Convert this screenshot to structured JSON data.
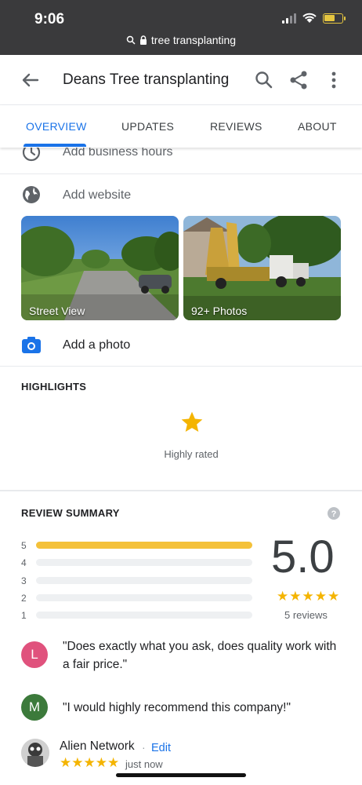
{
  "status_bar": {
    "time": "9:06"
  },
  "browser": {
    "url_text": "tree transplanting"
  },
  "header": {
    "title": "Deans Tree transplanting"
  },
  "tabs": [
    {
      "label": "OVERVIEW"
    },
    {
      "label": "UPDATES"
    },
    {
      "label": "REVIEWS"
    },
    {
      "label": "ABOUT"
    }
  ],
  "rows": {
    "hours_label": "Add business hours",
    "website_label": "Add website",
    "photo_label": "Add a photo"
  },
  "photos": [
    {
      "caption": "Street View"
    },
    {
      "caption": "92+ Photos"
    }
  ],
  "highlights": {
    "title": "HIGHLIGHTS",
    "item_label": "Highly rated",
    "item_icon": "star-icon"
  },
  "review_summary": {
    "title": "REVIEW SUMMARY",
    "score": "5.0",
    "stars": "★★★★★",
    "count_text": "5 reviews",
    "distribution": [
      {
        "label": "5",
        "fraction": 1.0
      },
      {
        "label": "4",
        "fraction": 0
      },
      {
        "label": "3",
        "fraction": 0
      },
      {
        "label": "2",
        "fraction": 0
      },
      {
        "label": "1",
        "fraction": 0
      }
    ]
  },
  "snippets": [
    {
      "initial": "L",
      "color": "#e0527d",
      "text": "\"Does exactly what you ask, does quality work with a fair price.\""
    },
    {
      "initial": "M",
      "color": "#3c7a3b",
      "text": "\"I would highly recommend this company!\""
    }
  ],
  "user_review": {
    "author": "Alien Network",
    "separator": "·",
    "edit_label": "Edit",
    "stars": "★★★★★",
    "time": "just now"
  },
  "colors": {
    "accent": "#1a73e8",
    "star": "#f4b400",
    "bar": "#f4c13a"
  }
}
